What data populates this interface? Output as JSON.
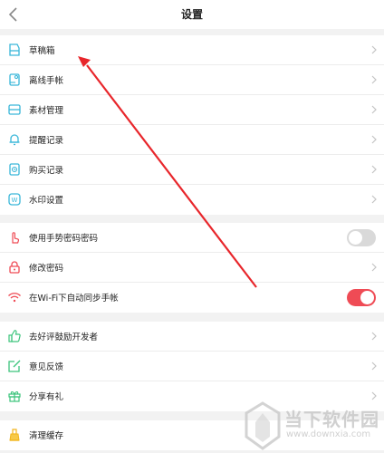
{
  "header": {
    "title": "设置",
    "back_icon": "chevron-left-icon"
  },
  "group1": [
    {
      "label": "草稿箱",
      "icon": "draft-icon"
    },
    {
      "label": "离线手帐",
      "icon": "offline-notebook-icon"
    },
    {
      "label": "素材管理",
      "icon": "material-icon"
    },
    {
      "label": "提醒记录",
      "icon": "bell-icon"
    },
    {
      "label": "购买记录",
      "icon": "purchase-record-icon"
    },
    {
      "label": "水印设置",
      "icon": "watermark-icon"
    }
  ],
  "group2": [
    {
      "label": "使用手势密码密码",
      "icon": "gesture-icon",
      "toggle": false
    },
    {
      "label": "修改密码",
      "icon": "lock-icon"
    },
    {
      "label": "在Wi-Fi下自动同步手帐",
      "icon": "wifi-icon",
      "toggle": true
    }
  ],
  "group3": [
    {
      "label": "去好评鼓励开发者",
      "icon": "thumbs-up-icon"
    },
    {
      "label": "意见反馈",
      "icon": "feedback-icon"
    },
    {
      "label": "分享有礼",
      "icon": "gift-icon"
    }
  ],
  "group4": [
    {
      "label": "清理缓存",
      "icon": "broom-icon"
    }
  ],
  "colors": {
    "accent_teal": "#3ab7d9",
    "toggle_on": "#ef4b55",
    "arrow": "#e8262b"
  },
  "watermark": {
    "title": "当下软件园",
    "url": "www.downxia.com"
  }
}
